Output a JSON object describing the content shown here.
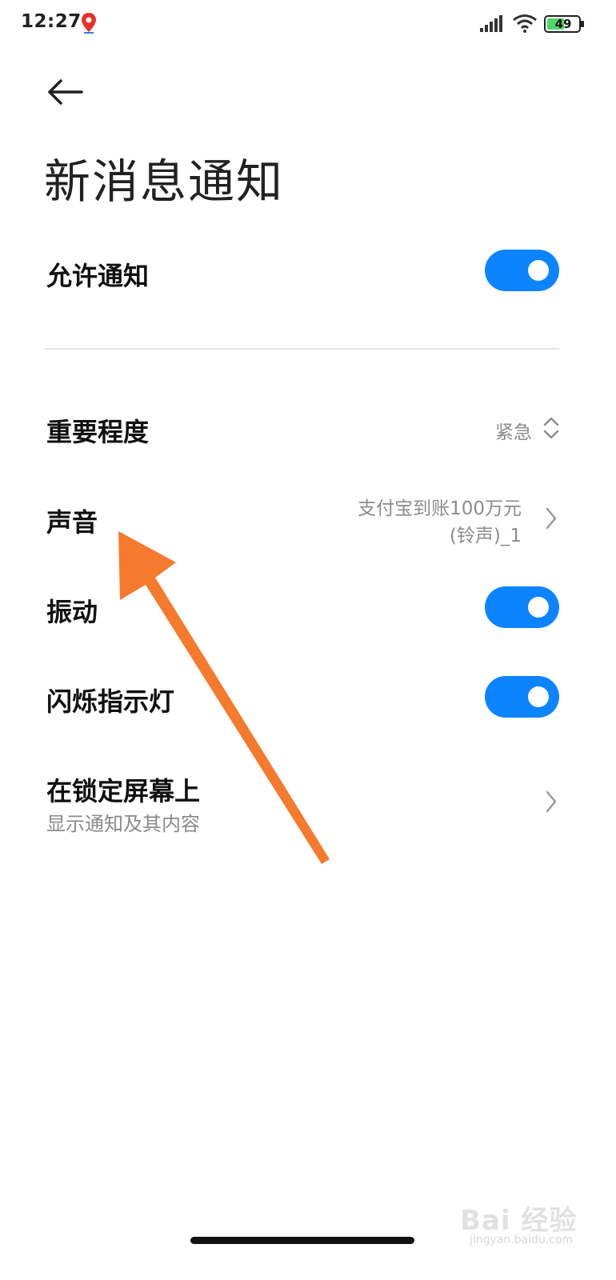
{
  "status_bar": {
    "time": "12:27",
    "battery": "49",
    "icons": [
      "baidu-map-icon",
      "signal-icon",
      "wifi-icon",
      "battery-icon"
    ]
  },
  "header": {
    "back_icon": "arrow-left-icon",
    "title": "新消息通知"
  },
  "settings": {
    "allow_notifications": {
      "label": "允许通知",
      "enabled": true
    },
    "importance": {
      "label": "重要程度",
      "value": "紧急"
    },
    "sound": {
      "label": "声音",
      "value_line1": "支付宝到账100万元",
      "value_line2": "(铃声)_1"
    },
    "vibration": {
      "label": "振动",
      "enabled": true
    },
    "blink_light": {
      "label": "闪烁指示灯",
      "enabled": true
    },
    "lock_screen": {
      "label": "在锁定屏幕上",
      "sublabel": "显示通知及其内容"
    }
  },
  "colors": {
    "toggle_on": "#0d84ff",
    "annotation_arrow": "#f57a2d"
  },
  "watermark": {
    "text": "Bai 经验",
    "url": "jingyan.baidu.com"
  }
}
